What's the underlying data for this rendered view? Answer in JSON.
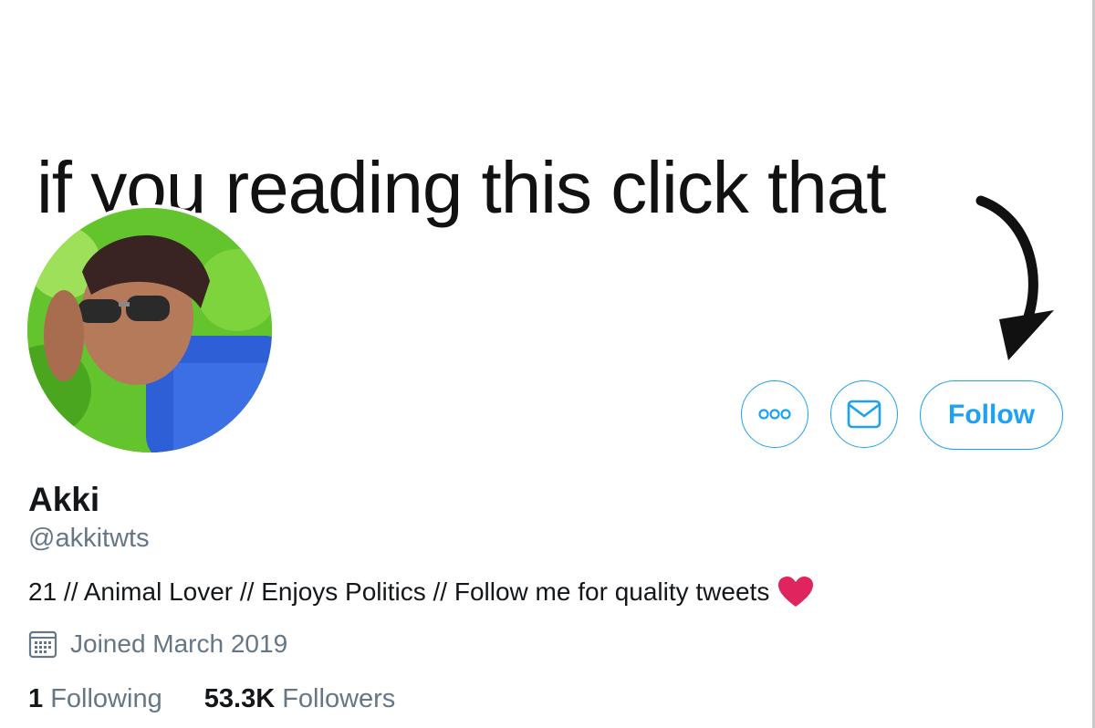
{
  "banner": {
    "text": "if you reading this click that"
  },
  "actions": {
    "more_label": "More",
    "message_label": "Message",
    "follow_label": "Follow"
  },
  "profile": {
    "name": "Akki",
    "handle": "@akkitwts",
    "bio": "21 // Animal Lover // Enjoys Politics // Follow me for quality tweets",
    "joined": "Joined March 2019",
    "following_count": "1",
    "following_label": "Following",
    "followers_count": "53.3K",
    "followers_label": "Followers"
  },
  "colors": {
    "accent": "#1da1f2",
    "secondary_text": "#657786",
    "heart": "#e0245e"
  },
  "icons": [
    "more-dots-icon",
    "envelope-icon",
    "calendar-icon",
    "heart-emoji-icon",
    "arrow-down-icon"
  ]
}
